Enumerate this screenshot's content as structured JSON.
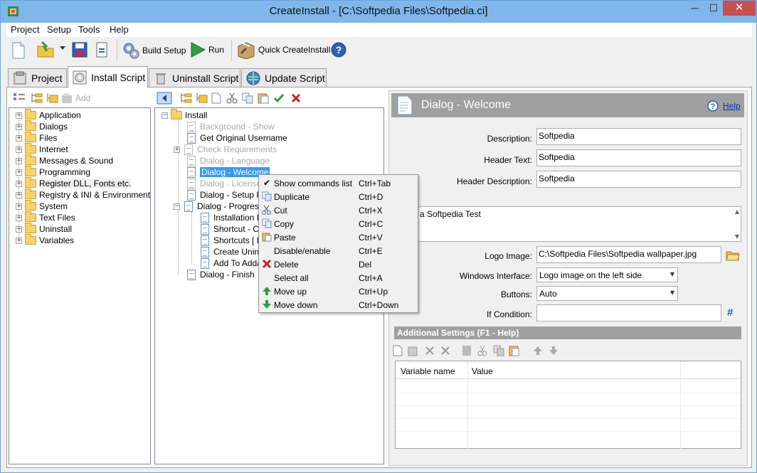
{
  "window": {
    "title": "CreateInstall - [C:\\Softpedia Files\\Softpedia.ci]",
    "min_glyph": "─",
    "max_glyph": "☐",
    "close_glyph": "✕"
  },
  "menu": [
    "Project",
    "Setup",
    "Tools",
    "Help"
  ],
  "toolbar": {
    "build_setup": "Build Setup",
    "run": "Run",
    "quick_createinstall": "Quick CreateInstall"
  },
  "tabs": [
    "Project",
    "Install Script",
    "Uninstall Script",
    "Update Script"
  ],
  "left_toolbar": {
    "add": "Add"
  },
  "command_tree": [
    "Application",
    "Dialogs",
    "Files",
    "Internet",
    "Messages & Sound",
    "Programming",
    "Register DLL, Fonts etc.",
    "Registry & INI & Environment",
    "System",
    "Text Files",
    "Uninstall",
    "Variables"
  ],
  "script_tree": {
    "root": "Install",
    "items": [
      {
        "label": "Background - Show",
        "disabled": true
      },
      {
        "label": "Get Original Username",
        "disabled": false
      },
      {
        "label": "Check Requirements",
        "disabled": true
      },
      {
        "label": "Dialog - Language",
        "disabled": true
      },
      {
        "label": "Dialog - Welcome",
        "disabled": false
      },
      {
        "label": "Dialog - License",
        "disabled": true
      },
      {
        "label": "Dialog - Setup Pa",
        "disabled": false
      },
      {
        "label": "Dialog - Progress",
        "disabled": false
      },
      {
        "label": "Installation Fil",
        "disabled": false
      },
      {
        "label": "Shortcut - Cre",
        "disabled": false
      },
      {
        "label": "Shortcuts [ Li",
        "disabled": false
      },
      {
        "label": "Create Uninst",
        "disabled": false
      },
      {
        "label": "Add To Add/",
        "disabled": false
      },
      {
        "label": "Dialog - Finish",
        "disabled": false
      }
    ]
  },
  "context_menu": [
    {
      "label": "Show commands list",
      "shortcut": "Ctrl+Tab",
      "icon": "check-icon"
    },
    {
      "label": "Duplicate",
      "shortcut": "Ctrl+D",
      "icon": "duplicate-icon"
    },
    {
      "label": "Cut",
      "shortcut": "Ctrl+X",
      "icon": "scissors-icon"
    },
    {
      "label": "Copy",
      "shortcut": "Ctrl+C",
      "icon": "copy-icon"
    },
    {
      "label": "Paste",
      "shortcut": "Ctrl+V",
      "icon": "paste-icon"
    },
    {
      "label": "Disable/enable",
      "shortcut": "Ctrl+E",
      "icon": ""
    },
    {
      "label": "Delete",
      "shortcut": "Del",
      "icon": "delete-icon"
    },
    {
      "label": "Select all",
      "shortcut": "Ctrl+A",
      "icon": ""
    },
    {
      "label": "Move up",
      "shortcut": "Ctrl+Up",
      "icon": "arrow-up-icon"
    },
    {
      "label": "Move down",
      "shortcut": "Ctrl+Down",
      "icon": "arrow-down-icon"
    }
  ],
  "dialog": {
    "title": "Dialog - Welcome",
    "help": "Help",
    "description_label": "Description:",
    "description_value": "Softpedia",
    "header_text_label": "Header Text:",
    "header_text_value": "Softpedia",
    "header_description_label": "Header Description:",
    "header_description_value": "Softpedia",
    "body_text": "a Softpedia Test",
    "logo_image_label": "Logo Image:",
    "logo_image_value": "C:\\Softpedia Files\\Softpedia wallpaper.jpg",
    "windows_interface_label": "Windows Interface:",
    "windows_interface_value": "Logo image on the left side",
    "buttons_label": "Buttons:",
    "buttons_value": "Auto",
    "if_condition_label": "If Condition:",
    "if_condition_value": "",
    "hash_glyph": "#"
  },
  "additional_settings": {
    "title": "Additional Settings (F1 - Help)",
    "columns": [
      "Variable name",
      "Value"
    ]
  },
  "colors": {
    "titlebar": "#7fb7ea",
    "close": "#c75050",
    "selection": "#3399ff",
    "panel_header": "#a0a0a0"
  }
}
